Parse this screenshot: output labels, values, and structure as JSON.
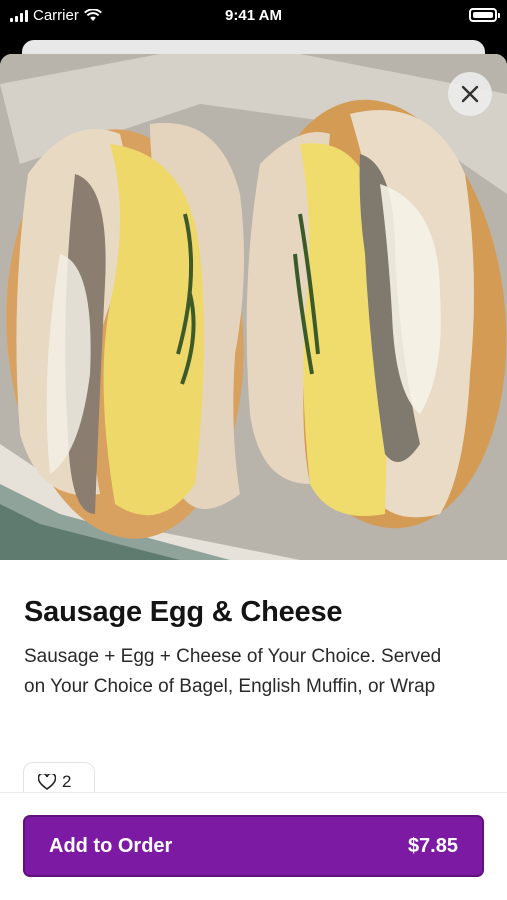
{
  "status_bar": {
    "carrier": "Carrier",
    "time": "9:41 AM"
  },
  "item": {
    "title": "Sausage Egg & Cheese",
    "description": "Sausage + Egg + Cheese of Your Choice. Served on Your Choice of Bagel, English Muffin, or Wrap",
    "like_count": "2"
  },
  "order": {
    "label": "Add to Order",
    "price": "$7.85"
  },
  "colors": {
    "accent": "#7d1aa3"
  }
}
